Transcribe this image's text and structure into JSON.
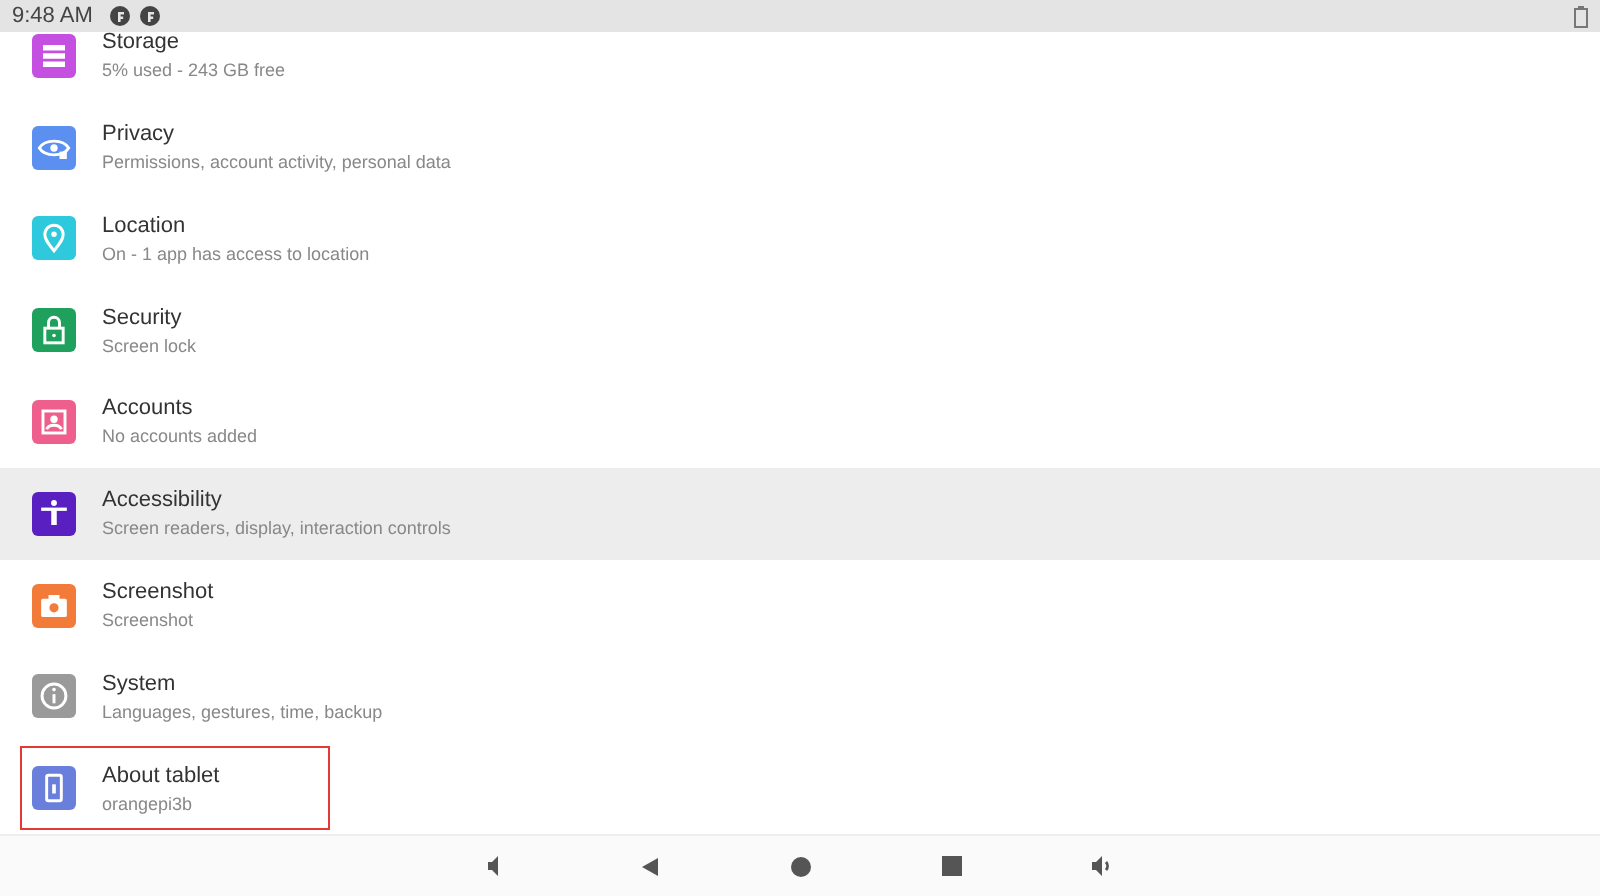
{
  "status_bar": {
    "time": "9:48 AM"
  },
  "settings": [
    {
      "title": "Storage",
      "summary": "5% used - 243 GB free",
      "color": "#c44fe0",
      "highlighted": false,
      "outlined": false
    },
    {
      "title": "Privacy",
      "summary": "Permissions, account activity, personal data",
      "color": "#5b8ff0",
      "highlighted": false,
      "outlined": false
    },
    {
      "title": "Location",
      "summary": "On - 1 app has access to location",
      "color": "#2ec9dc",
      "highlighted": false,
      "outlined": false
    },
    {
      "title": "Security",
      "summary": "Screen lock",
      "color": "#1fa05c",
      "highlighted": false,
      "outlined": false
    },
    {
      "title": "Accounts",
      "summary": "No accounts added",
      "color": "#ef5f8e",
      "highlighted": false,
      "outlined": false
    },
    {
      "title": "Accessibility",
      "summary": "Screen readers, display, interaction controls",
      "color": "#5a1fc0",
      "highlighted": true,
      "outlined": false
    },
    {
      "title": "Screenshot",
      "summary": "Screenshot",
      "color": "#f27b3a",
      "highlighted": false,
      "outlined": false
    },
    {
      "title": "System",
      "summary": "Languages, gestures, time, backup",
      "color": "#9a9a9a",
      "highlighted": false,
      "outlined": false
    },
    {
      "title": "About tablet",
      "summary": "orangepi3b",
      "color": "#6a7fdc",
      "highlighted": false,
      "outlined": true
    }
  ]
}
